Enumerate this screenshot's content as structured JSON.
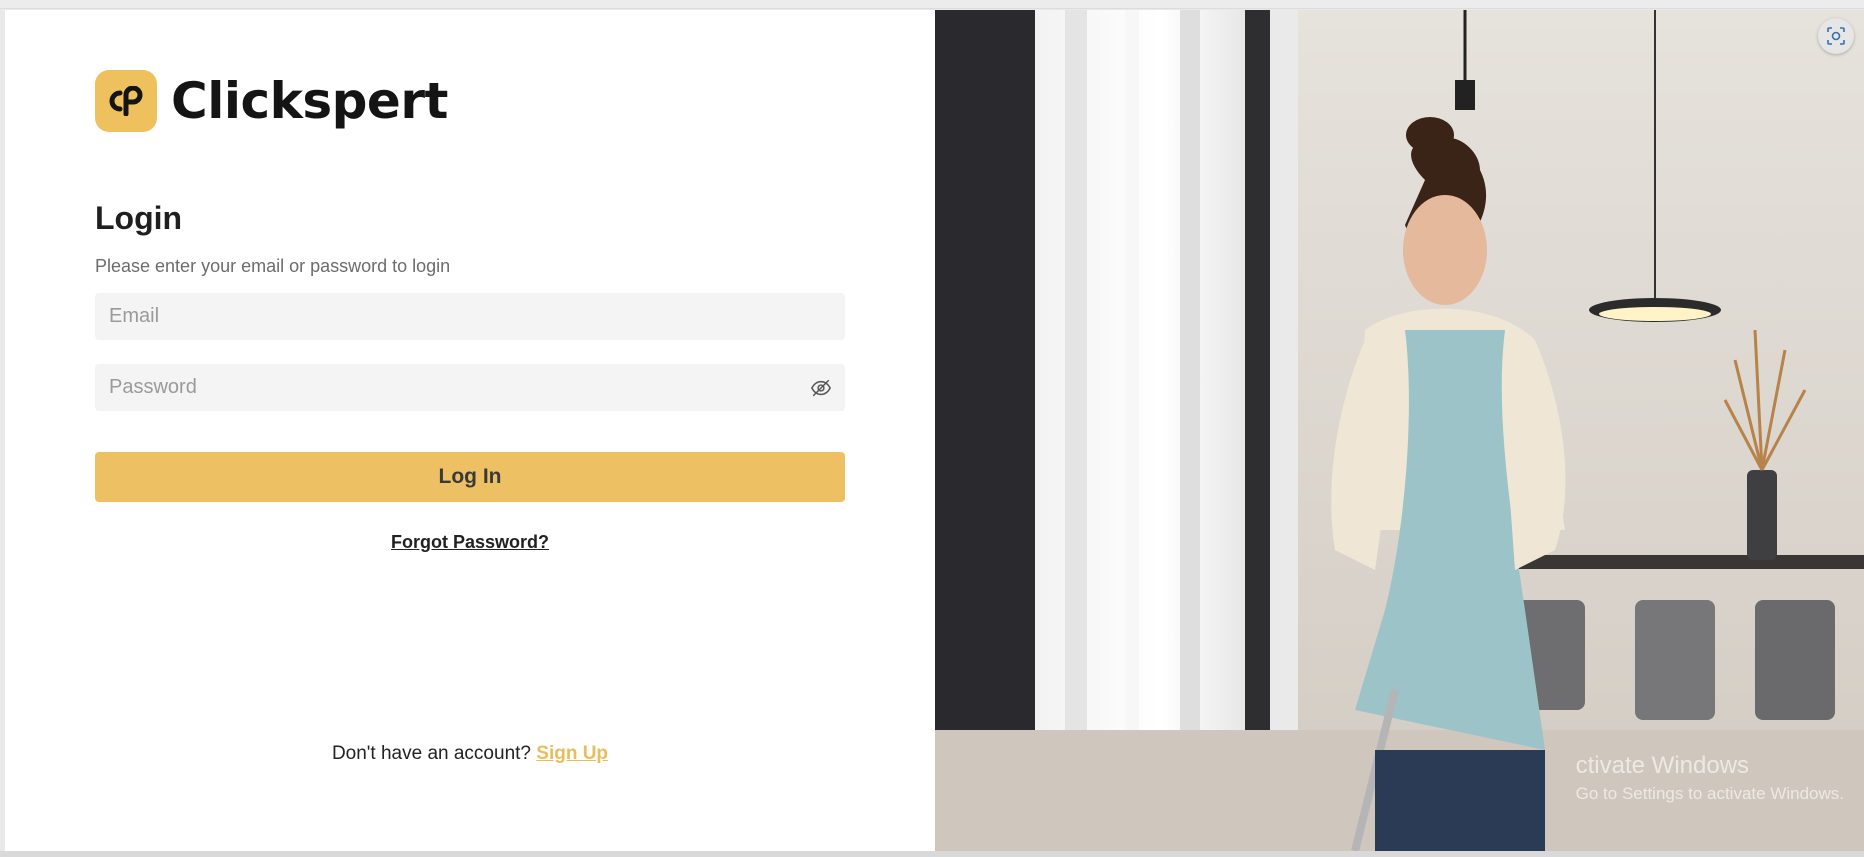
{
  "brand": {
    "name": "Clickspert",
    "mark_text": "cp",
    "accent_color": "#EDC163"
  },
  "login": {
    "title": "Login",
    "subtitle": "Please enter your email or password to login",
    "email_placeholder": "Email",
    "password_placeholder": "Password",
    "submit_label": "Log In",
    "forgot_label": "Forgot Password?",
    "signup_prompt": "Don't have an account?",
    "signup_label": "Sign Up"
  },
  "icons": {
    "password_toggle": "eye-off-icon",
    "scan": "screenshot-scan-icon"
  },
  "watermark": {
    "line1": "ctivate Windows",
    "line2": "Go to Settings to activate Windows."
  }
}
